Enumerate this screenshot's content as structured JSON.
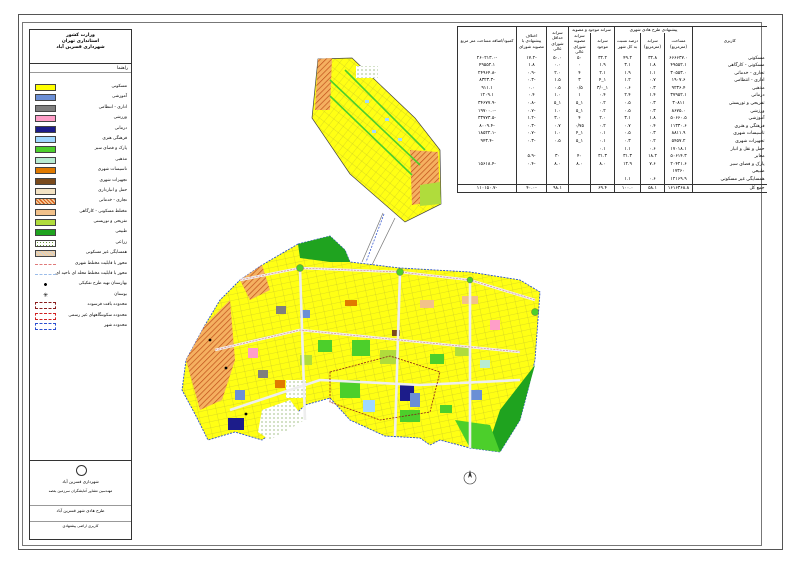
{
  "legend": {
    "title_lines": [
      "وزارت کشور",
      "استانداری تهران",
      "شهرداری قسرین آباد"
    ],
    "header": "راهنما",
    "items": [
      {
        "label": "مسکونی",
        "color": "#ffff00",
        "pattern": "solid"
      },
      {
        "label": "آموزشی",
        "color": "#6b8fd6",
        "pattern": "solid"
      },
      {
        "label": "اداری - انتظامی",
        "color": "#7f7f7f",
        "pattern": "solid"
      },
      {
        "label": "ورزشی",
        "color": "#ff9ec8",
        "pattern": "solid"
      },
      {
        "label": "درمانی",
        "color": "#1c1c8a",
        "pattern": "solid"
      },
      {
        "label": "فرهنگی هنری",
        "color": "#9fd8ff",
        "pattern": "solid"
      },
      {
        "label": "پارک و فضای سبز",
        "color": "#4ccf2b",
        "pattern": "solid"
      },
      {
        "label": "مذهبی",
        "color": "#b8ecd2",
        "pattern": "solid"
      },
      {
        "label": "تاسیسات شهری",
        "color": "#e07a00",
        "pattern": "solid"
      },
      {
        "label": "تجهیزات شهری",
        "color": "#7a4a1c",
        "pattern": "solid"
      },
      {
        "label": "حمل و انبارداری",
        "color": "#f4e3c4",
        "pattern": "solid"
      },
      {
        "label": "تجاری - خدماتی",
        "color": "#d9601a",
        "pattern": "hatch"
      },
      {
        "label": "مختلط مسکونی - کارگاهی",
        "color": "#f2c18a",
        "pattern": "solid"
      },
      {
        "label": "تفریحی و توریستی",
        "color": "#b0dc3c",
        "pattern": "solid"
      },
      {
        "label": "طبیعی",
        "color": "#1fa31f",
        "pattern": "solid"
      },
      {
        "label": "زراعی",
        "color": "#ffffff",
        "pattern": "dots"
      },
      {
        "label": "همسایگی غیر مسکونی",
        "color": "#d0d0d0",
        "pattern": "hatch"
      },
      {
        "label": "محور با قابلیت مختلط شهری",
        "color": "#e07a7a",
        "pattern": "dashline"
      },
      {
        "label": "محور با قابلیت مختلط محله ای ناحیه ای",
        "color": "#9bbdea",
        "pattern": "dashline"
      },
      {
        "label": "بهارستان تهیه طرح تفکیکی",
        "color": "#000000",
        "pattern": "dot"
      },
      {
        "label": "بوستان",
        "color": "#000000",
        "pattern": "star"
      },
      {
        "label": "محدوده بافت فرسوده",
        "color": "#8a1c1c",
        "pattern": "dashbox"
      },
      {
        "label": "محدوده سکونتگاههای غیر رسمی",
        "color": "#d02020",
        "pattern": "dashbox"
      },
      {
        "label": "محدوده شهر",
        "color": "#2a4fd0",
        "pattern": "dashbox"
      }
    ],
    "footer": {
      "org": "شهرداری قسرین آباد",
      "consultant": "مهندسین مشاور آمایشگران سرزمین بعصه",
      "project": "طرح هادی شهر قسرین آباد",
      "sheet": "کاربری اراضی پیشنهادی"
    }
  },
  "table": {
    "headers": {
      "group_proposed": "پیشنهادی طرح هادی شهری",
      "group_existing": "سرانه موجود و مصوبه",
      "use": "کاربری",
      "area": "مساحت (مترمربع)",
      "per_capita": "سرانه (مترمربع)",
      "percent": "درصد نسبت به کل شهر",
      "existing_pc": "سرانه موجود",
      "approved_pc": "سرانه مصوبه شورای عالی",
      "min_pc": "سرانه حداقل شورای عالی",
      "diff_pc": "اختلاف پیشنهادی با مصوبه شورای",
      "deficit": "کمبود/اضافه مساحت متر مربع"
    },
    "rows": [
      {
        "name": "مسکونی",
        "area": "۶۶۶۶۳۷.۰",
        "pc": "۳۲.۸",
        "pct": "۴۹.۲",
        "ex": "۳۲.۲",
        "ap": "۵۰",
        "mn": "۵۰.۰",
        "diff": "-۱۷.۲",
        "def": "-۲۶۰۲۱۳.۰"
      },
      {
        "name": "مسکونی - کارگاهی",
        "area": "۴۹۵۵۲.۱",
        "pc": "۱.۸",
        "pct": "۳.۱",
        "ex": "۱.۹",
        "ap": "۰",
        "mn": "۰.۰",
        "diff": "۱.۸",
        "def": "۴۹۵۵۲.۱"
      },
      {
        "name": "تجاری - خدماتی",
        "area": "۳۰۵۵۳.۰",
        "pc": "۱.۱",
        "pct": "۱.۹",
        "ex": "۲.۱",
        "ap": "۴",
        "mn": "۲.۰",
        "diff": "-۰.۹",
        "def": "-۲۴۹۶۴.۸"
      },
      {
        "name": "اداری - انتظامی",
        "area": "۱۹۰۷.۶",
        "pc": "۰.۷",
        "pct": "۱.۲",
        "ex": "۱_۴",
        "ap": "۳",
        "mn": "۱.۵",
        "diff": "-۰.۳",
        "def": "-۸۳۲۳.۳"
      },
      {
        "name": "مذهبی",
        "area": "۹۲۳۶.۴",
        "pc": "۰.۳",
        "pct": "۰.۶",
        "ex": "۱_۳/۰",
        "ap": "۰/۵",
        "mn": "۰.۵",
        "diff": "۰.۰",
        "def": "۹۱۱.۱"
      },
      {
        "name": "درمانی",
        "area": "۳۷۹۵۲.۱",
        "pc": "۱.۴",
        "pct": "۲.۴",
        "ex": "۰.۴",
        "ap": "۱",
        "mn": "۱.۰",
        "diff": "۰.۴",
        "def": "۱۲۰۹.۱"
      },
      {
        "name": "تفریحی و توریستی",
        "area": "۳۰۸۱۱",
        "pc": "۰.۳",
        "pct": "۰.۵",
        "ex": "۰.۲",
        "ap": "۱_۵",
        "mn": "۱_۵",
        "diff": "-۰.۸",
        "def": "-۳۴۶۷۷.۹"
      },
      {
        "name": "ورزشی",
        "area": "۸۶۷۵.۰",
        "pc": "۰.۳",
        "pct": "۰.۵",
        "ex": "۰.۲",
        "ap": "۱_۵",
        "mn": "۱.۰",
        "diff": "-۰.۷",
        "def": "-۱۹۷۰۰.۰"
      },
      {
        "name": "آموزشی",
        "area": "۵۰۶۶۰.۵",
        "pc": "۱.۸",
        "pct": "۳.۱",
        "ex": "۲.۰",
        "ap": "۴",
        "mn": "۳.۰",
        "diff": "-۱.۲",
        "def": "-۳۳۷۷۳.۵"
      },
      {
        "name": "فرهنگی و هنری",
        "area": "۱۱۳۳۰.۶",
        "pc": "۰.۴",
        "pct": "۰.۷",
        "ex": "۰.۲",
        "ap": "۰/۷۵",
        "mn": "۰.۷",
        "diff": "-۰.۳",
        "def": "-۸۰۰۹.۴"
      },
      {
        "name": "تاسیسات شهری",
        "area": "۸۸۱۱.۹",
        "pc": "۰.۳",
        "pct": "۰.۵",
        "ex": "۰.۱",
        "ap": "۱_۴",
        "mn": "۱.۰",
        "diff": "-۰.۷",
        "def": "-۱۸۵۲۲.۱"
      },
      {
        "name": "تجهیزات شهری",
        "area": "۵۴۵۷.۲",
        "pc": "۰.۲",
        "pct": "۰.۳",
        "ex": "۰.۱",
        "ap": "۱_۵",
        "mn": "۰.۵",
        "diff": "-۰.۳",
        "def": "-۹۴۳.۴"
      },
      {
        "name": "حمل و نقل و انبار",
        "area": "۱۷۰۱۸.۱",
        "pc": "۰.۶",
        "pct": "۱.۱",
        "ex": "۰.۱",
        "ap": "",
        "mn": "",
        "diff": "",
        "def": ""
      },
      {
        "name": "معابر",
        "area": "۵۰۶۱۴.۳",
        "pc": "۱۸.۲",
        "pct": "۳۱.۳",
        "ex": "۳۱.۳",
        "ap": "۴۰",
        "mn": "۳۰",
        "diff": "-۵.۹",
        "def": ""
      },
      {
        "name": "پارک و فضای سبز",
        "area": "۲۰۴۲۱.۶",
        "pc": "۷.۶",
        "pct": "۱۲.۹",
        "ex": "۸.۰",
        "ap": "۸.۰",
        "mn": "۸.۰",
        "diff": "-۰.۴",
        "def": "-۱۵۶۱۸.۴"
      },
      {
        "name": "طبیعی",
        "area": "۱۷۳۶۰",
        "pc": "",
        "pct": "",
        "ex": "",
        "ap": "",
        "mn": "",
        "diff": "",
        "def": ""
      },
      {
        "name": "همسایگی غیر مسکونی",
        "area": "۱۲۱۶۹.۹",
        "pc": "۰.۶",
        "pct": "۱.۱",
        "ex": "",
        "ap": "",
        "mn": "",
        "diff": "",
        "def": ""
      }
    ],
    "total": {
      "name": "جمع کل",
      "area": "۱۶۱۶۳۶۸.۸",
      "pc": "۵۸.۱",
      "pct": "۱۰۰.۰",
      "ex": "۶۹.۴",
      "ap": "",
      "mn": "۹۸.۱",
      "diff": "-۴۰.۰",
      "def": "-۱۱۰۱۵۰.۷"
    }
  }
}
